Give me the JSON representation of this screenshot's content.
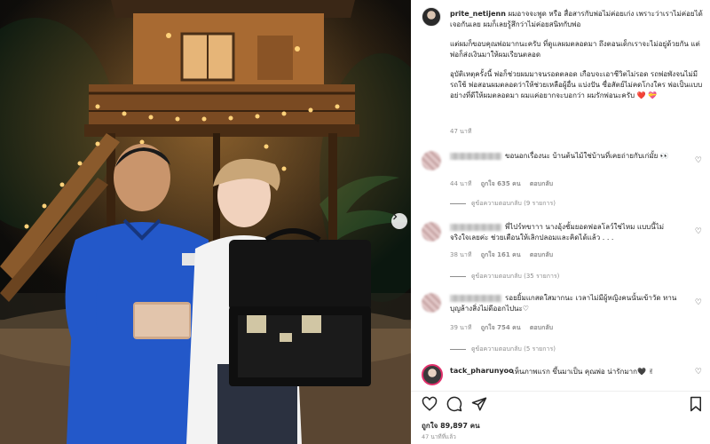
{
  "post": {
    "username": "prite_netijenn",
    "caption_paragraphs": [
      "ผมอาจจะพูด หรือ สื่อสารกับพ่อไม่ค่อยเก่ง เพราะว่าเราไม่ค่อยได้เจอกันเลย ผมก็เลยรู้สึกว่าไม่ค่อยสนิทกับพ่อ",
      "แต่ผมก็ขอบคุณพ่อมากนะครับ ที่ดูแลผมตลอดมา ถึงตอนเด็กเราจะไม่อยู่ด้วยกัน แต่พ่อก็ส่งเงินมาให้ผมเรียนตลอด",
      "อุบัติเหตุครั้งนี้ พ่อก็ช่วยผมมาจนรอดตลอด เกือบจะเอาชีวิตไม่รอด รถพ่อพังจนไม่มีรถใช้ พ่อสอนผมตลอดว่าให้ช่วยเหลือผู้อื่น แบ่งปัน ซื่อสัตย์ไม่คดโกงใคร พ่อเป็นแบบอย่างที่ดีให้ผมตลอดมา ผมแค่อยากจะบอกว่า ผมรักพ่อนะครับ ❤️ 💝"
    ],
    "caption_time": "47 นาที",
    "likes": "ถูกใจ 89,897 คน",
    "post_time": "47 นาทีที่แล้ว"
  },
  "comments": [
    {
      "text": "ขอนอกเรื่องนะ บ้านต้นไม้ใช่บ้านที่เคยถ่ายกับเก่มั้ย 👀",
      "time": "44 นาที",
      "likes": "ถูกใจ 635 คน",
      "reply": "ตอบกลับ",
      "view_replies": "ดูข้อความตอบกลับ (9 รายการ)"
    },
    {
      "text": "พี่ไปร์ทขาาา นางอุ้งชั้มยอดฟอลโลว์ใช่ไหม แบบนี้ไม่จริงใจเลยค่ะ ช่วยเตือนให้เลิกปลอมและคิดได้แล้ว . . .",
      "time": "38 นาที",
      "likes": "ถูกใจ 161 คน",
      "reply": "ตอบกลับ",
      "view_replies": "ดูข้อความตอบกลับ (35 รายการ)"
    },
    {
      "text": "รอยยิ้มแกสดใสมากนะ เวลาไม่มีผู้หญิงคนนั้นเข้าวัด ทานบุญล้างสิ่งไม่ดีออกไปนะ♡",
      "time": "39 นาที",
      "likes": "ถูกใจ 754 คน",
      "reply": "ตอบกลับ",
      "view_replies": "ดูข้อความตอบกลับ (5 รายการ)"
    }
  ],
  "tagged_comment": {
    "username": "tack_pharunyoo",
    "text": "เห็นภาพแรก ขึ้นมาเป็น คุณพ่อ น่ารักมาก🖤 ✌"
  },
  "icons": {
    "like": "heart-icon",
    "comment": "comment-icon",
    "share": "share-icon",
    "save": "bookmark-icon",
    "next": "chevron-right-icon"
  }
}
